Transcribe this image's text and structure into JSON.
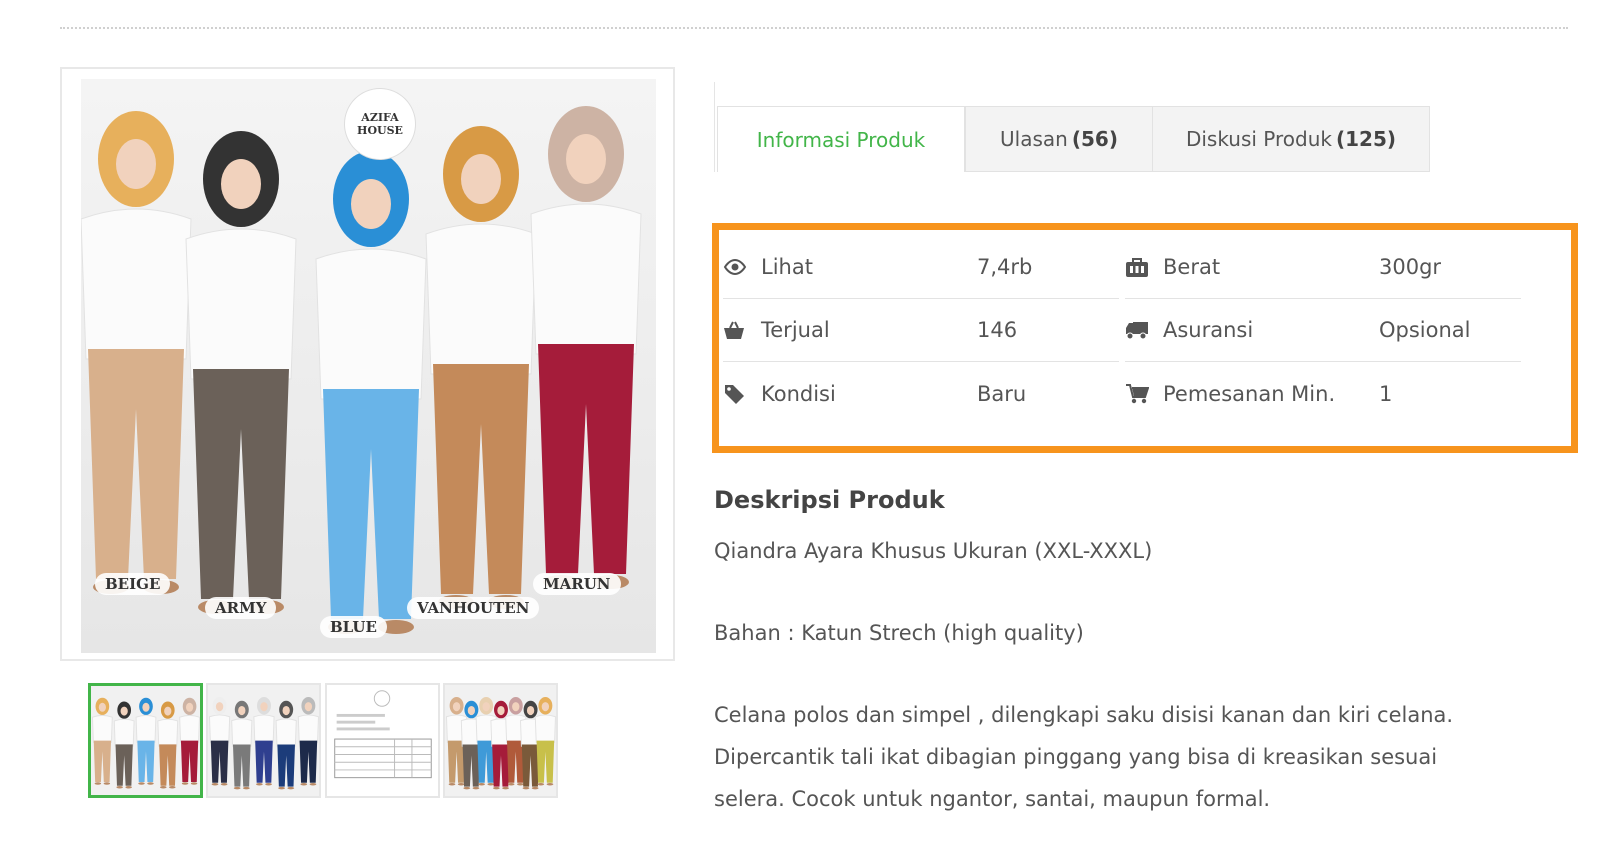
{
  "gallery": {
    "brand_line1": "AZIFA",
    "brand_line2": "HOUSE",
    "color_labels": [
      "BEIGE",
      "ARMY",
      "BLUE",
      "VANHOUTEN",
      "MARUN"
    ],
    "garment_colors": [
      "#d8b08c",
      "#6b6159",
      "#69b4e8",
      "#c48a5a",
      "#a51c3a"
    ],
    "scarf_colors": [
      "#e7b05c",
      "#333333",
      "#2a8fd6",
      "#d89a45",
      "#cdb3a4"
    ]
  },
  "tabs": [
    {
      "label": "Informasi Produk",
      "count": ""
    },
    {
      "label": "Ulasan",
      "count": "(56)"
    },
    {
      "label": "Diskusi Produk",
      "count": "(125)"
    }
  ],
  "info": {
    "left": [
      {
        "icon": "eye-icon",
        "label": "Lihat",
        "value": "7,4rb"
      },
      {
        "icon": "basket-icon",
        "label": "Terjual",
        "value": "146"
      },
      {
        "icon": "tag-icon",
        "label": "Kondisi",
        "value": "Baru"
      }
    ],
    "right": [
      {
        "icon": "weight-icon",
        "label": "Berat",
        "value": "300gr"
      },
      {
        "icon": "truck-icon",
        "label": "Asuransi",
        "value": "Opsional"
      },
      {
        "icon": "cart-icon",
        "label": "Pemesanan Min.",
        "value": "1"
      }
    ]
  },
  "description": {
    "title": "Deskripsi Produk",
    "p1": "Qiandra Ayara Khusus Ukuran (XXL-XXXL)",
    "p2": "Bahan : Katun Strech (high quality)",
    "p3_line1": "Celana polos dan simpel , dilengkapi saku disisi kanan dan kiri celana.",
    "p3_line2": "Dipercantik tali ikat dibagian pinggang yang bisa di kreasikan sesuai",
    "p3_line3": "selera. Cocok untuk ngantor, santai, maupun formal."
  },
  "colors": {
    "accent": "#42b549",
    "highlight": "#f7941d"
  }
}
